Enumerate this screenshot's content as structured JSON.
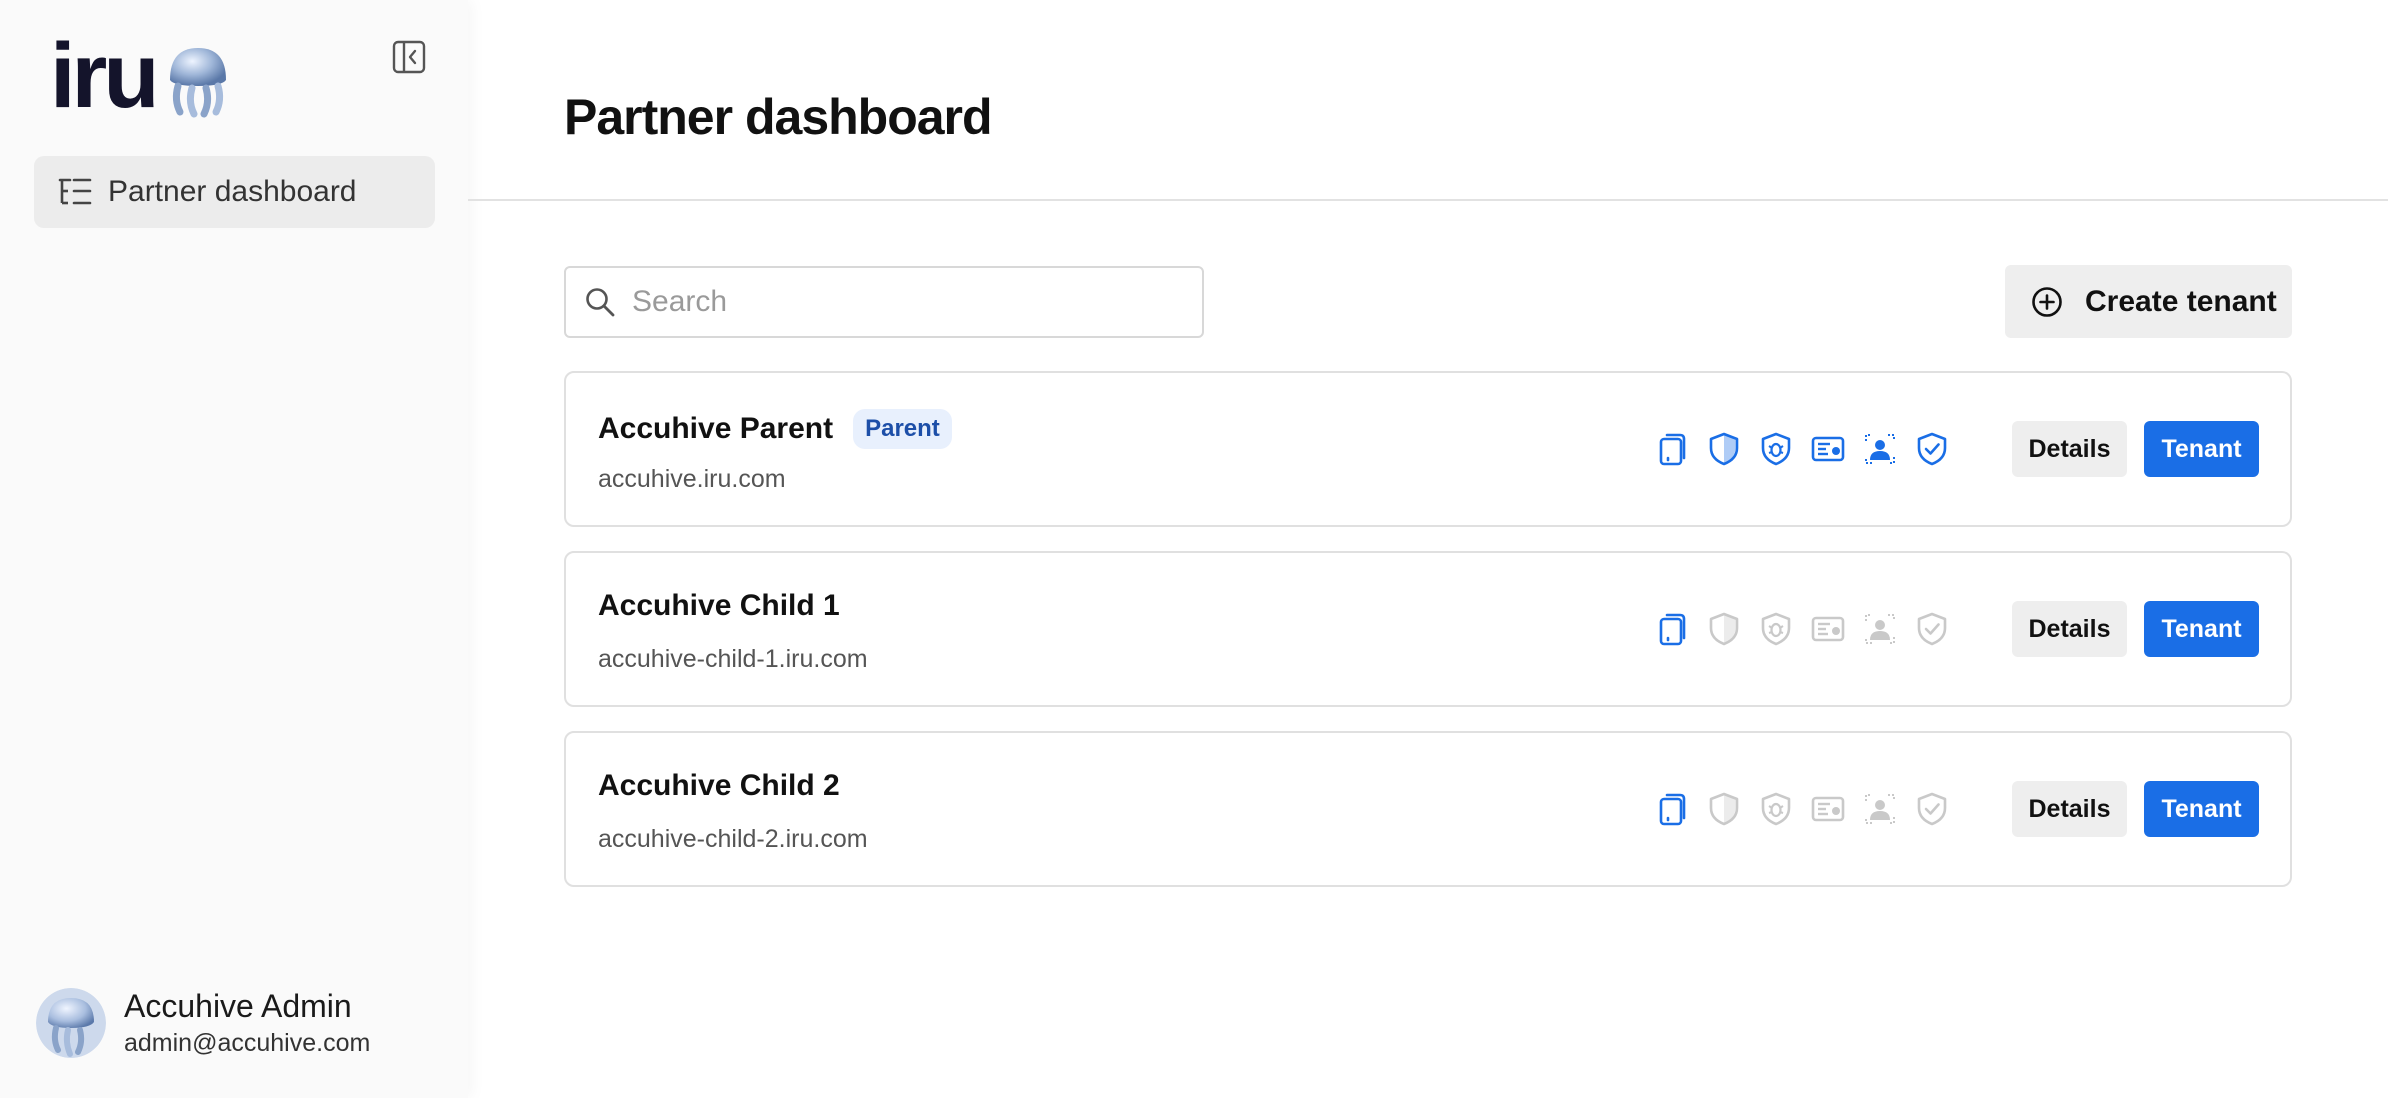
{
  "app": {
    "logo_text": "iru",
    "page_title": "Partner dashboard"
  },
  "sidebar": {
    "collapse_icon": "sidebar-collapse-icon",
    "nav_items": [
      {
        "label": "Partner dashboard",
        "icon": "list-tree-icon"
      }
    ],
    "user": {
      "name": "Accuhive Admin",
      "email": "admin@accuhive.com"
    }
  },
  "toolbar": {
    "search_placeholder": "Search",
    "search_value": "",
    "create_label": "Create tenant"
  },
  "colors": {
    "accent": "#1a6ee6",
    "icon_active": "#1a6ee6",
    "icon_inactive": "#c9c9c9"
  },
  "tenants": [
    {
      "name": "Accuhive Parent",
      "badge": "Parent",
      "domain": "accuhive.iru.com",
      "details_label": "Details",
      "tenant_label": "Tenant",
      "features": [
        true,
        true,
        true,
        true,
        true,
        true
      ]
    },
    {
      "name": "Accuhive Child 1",
      "badge": "",
      "domain": "accuhive-child-1.iru.com",
      "details_label": "Details",
      "tenant_label": "Tenant",
      "features": [
        true,
        false,
        false,
        false,
        false,
        false
      ]
    },
    {
      "name": "Accuhive Child 2",
      "badge": "",
      "domain": "accuhive-child-2.iru.com",
      "details_label": "Details",
      "tenant_label": "Tenant",
      "features": [
        true,
        false,
        false,
        false,
        false,
        false
      ]
    }
  ],
  "feature_icons": [
    "device-icon",
    "shield-icon",
    "bug-shield-icon",
    "id-card-icon",
    "user-scan-icon",
    "shield-check-icon"
  ]
}
